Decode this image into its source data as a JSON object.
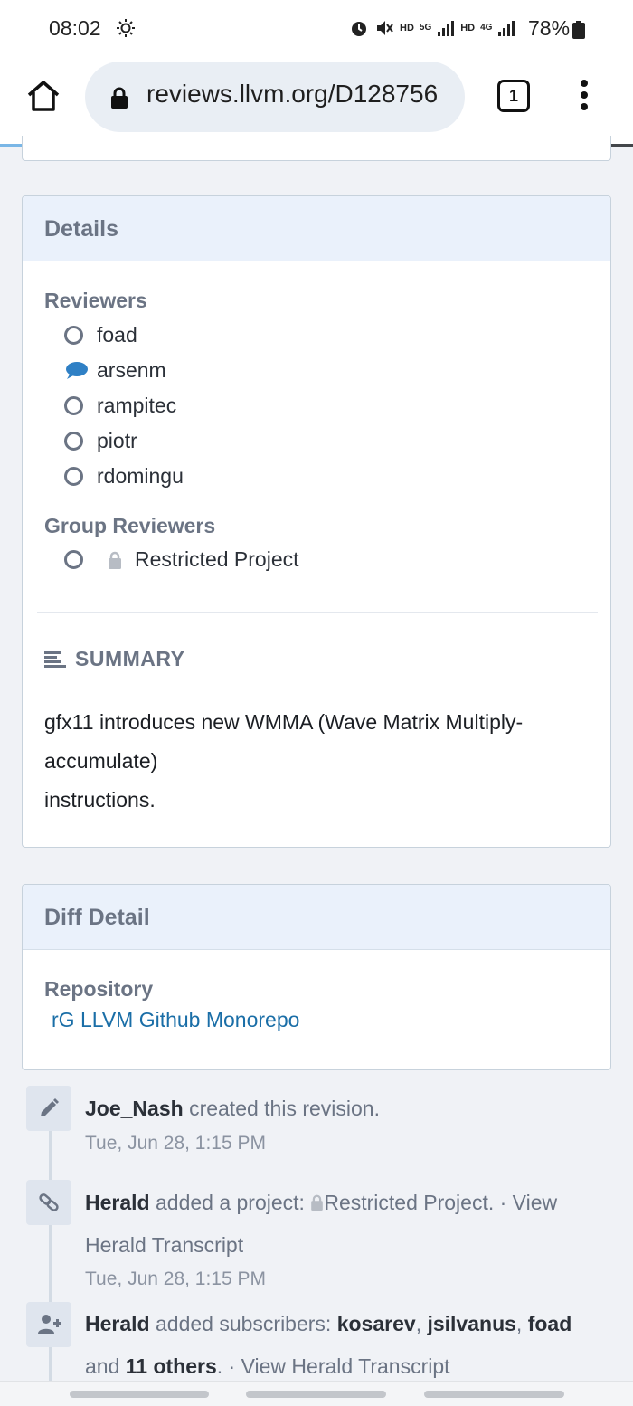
{
  "status_bar": {
    "time": "08:02",
    "hd1": "HD",
    "net5g": "5G",
    "hd2": "HD",
    "net4g": "4G",
    "battery": "78%"
  },
  "browser": {
    "url": "reviews.llvm.org/D128756",
    "tab_count": "1"
  },
  "details": {
    "header": "Details",
    "reviewers_label": "Reviewers",
    "reviewers": [
      {
        "name": "foad",
        "status": "circle"
      },
      {
        "name": "arsenm",
        "status": "comment"
      },
      {
        "name": "rampitec",
        "status": "circle"
      },
      {
        "name": "piotr",
        "status": "circle"
      },
      {
        "name": "rdomingu",
        "status": "circle"
      }
    ],
    "group_reviewers_label": "Group Reviewers",
    "group_reviewers": [
      {
        "name": "Restricted Project"
      }
    ],
    "summary_label": "SUMMARY",
    "summary_lines": [
      "gfx11 introduces new WMMA (Wave Matrix Multiply-",
      "accumulate)",
      "instructions."
    ]
  },
  "diff_detail": {
    "header": "Diff Detail",
    "repository_label": "Repository",
    "repository_link": "rG LLVM Github Monorepo"
  },
  "timeline": [
    {
      "icon": "pencil-icon",
      "actor": "Joe_Nash",
      "text": "created this revision.",
      "date": "Tue, Jun 28, 1:15 PM"
    },
    {
      "icon": "link-icon",
      "actor": "Herald",
      "text": "added a project:",
      "project": "Restricted Project.",
      "link": "· View",
      "link2": "Herald Transcript",
      "date": "Tue, Jun 28, 1:15 PM"
    },
    {
      "icon": "add-user-icon",
      "actor": "Herald",
      "text": "added subscribers:",
      "sub1": "kosarev",
      "sub2": "jsilvanus",
      "sub3": "foad",
      "and_text": "and",
      "others": "11 others",
      "link": ". · View Herald Transcript"
    }
  ],
  "colors": {
    "accent_link": "#1a6ea7",
    "comment_blue": "#2f80c5",
    "header_bg": "#eaf1fb",
    "muted": "#6b7484"
  }
}
